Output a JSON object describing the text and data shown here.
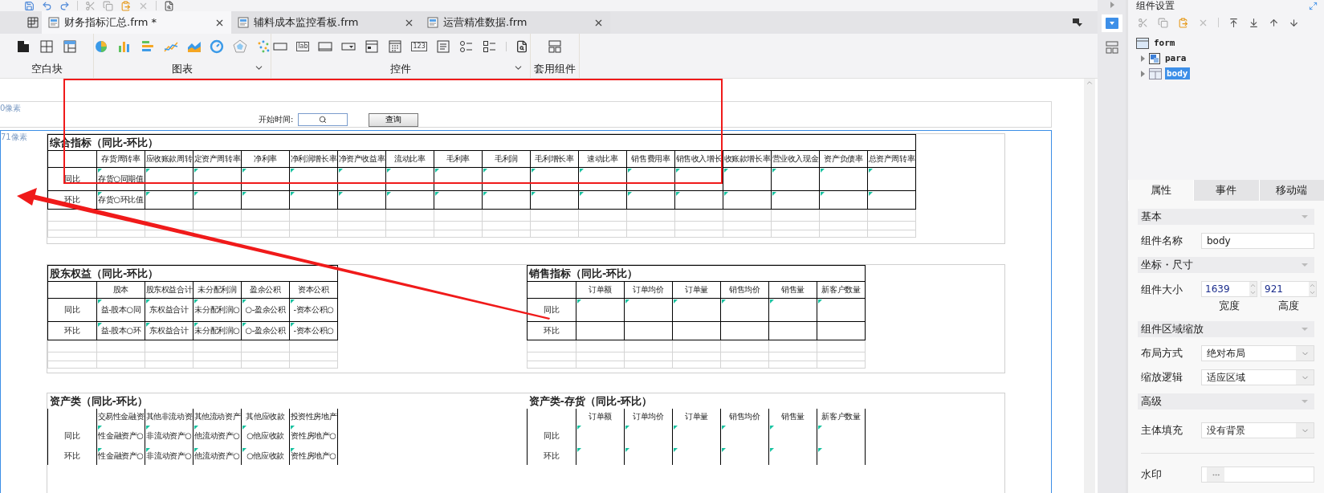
{
  "toolbar": {
    "tools": [
      {
        "kind": "save"
      },
      {
        "kind": "undo"
      },
      {
        "kind": "redo"
      },
      {
        "kind": "sep"
      },
      {
        "kind": "cut"
      },
      {
        "kind": "copy"
      },
      {
        "kind": "paste"
      },
      {
        "kind": "delete"
      },
      {
        "kind": "sep"
      },
      {
        "kind": "preview"
      }
    ]
  },
  "tabs": [
    {
      "label": "财务指标汇总.frm *",
      "selected": true
    },
    {
      "label": "辅料成本监控看板.frm",
      "selected": false
    },
    {
      "label": "运营精准数据.frm",
      "selected": false
    }
  ],
  "ribbon": {
    "groups": [
      {
        "label": "空白块",
        "menu": false,
        "tools": [
          {
            "kind": "block"
          },
          {
            "kind": "grid"
          },
          {
            "kind": "table"
          }
        ]
      },
      {
        "label": "图表",
        "menu": true,
        "tools": [
          {
            "kind": "pie"
          },
          {
            "kind": "bar"
          },
          {
            "kind": "hbar"
          },
          {
            "kind": "line"
          },
          {
            "kind": "area"
          },
          {
            "kind": "gauge"
          },
          {
            "kind": "radar"
          },
          {
            "kind": "scatter"
          }
        ]
      },
      {
        "label": "控件",
        "menu": true,
        "tools": [
          {
            "kind": "textbox"
          },
          {
            "kind": "glyph",
            "glyph": "lab"
          },
          {
            "kind": "textarea"
          },
          {
            "kind": "dropdown"
          },
          {
            "kind": "date"
          },
          {
            "kind": "calendar"
          },
          {
            "kind": "glyph",
            "glyph": "123"
          },
          {
            "kind": "list"
          },
          {
            "kind": "radio"
          },
          {
            "kind": "checkbox"
          },
          {
            "kind": "sep"
          },
          {
            "kind": "preview"
          }
        ]
      },
      {
        "label": "套用组件",
        "menu": false,
        "tools": [
          {
            "kind": "template"
          }
        ]
      }
    ]
  },
  "canvas": {
    "para": {
      "ruler": "0像素",
      "field_label": "开始时间:",
      "button": "查询"
    },
    "body": {
      "ruler": "71像素",
      "sections": [
        {
          "tables": [
            {
              "title": "综合指标（同比-环比）",
              "kind": "grid",
              "columns": [
                "存货周转率",
                "应收账款周转",
                "定资产周转率",
                "净利率",
                "净利润增长率",
                "净资产收益率",
                "流动比率",
                "毛利率",
                "毛利润",
                "毛利增长率",
                "速动比率",
                "销售费用率",
                "销售收入增长",
                "收账款增长率",
                "营业收入现金",
                "资产负债率",
                "总资产周转率"
              ],
              "rows": [
                {
                  "label": "同比",
                  "flagged": true,
                  "cells": [
                    "存货○同期值"
                  ]
                },
                {
                  "label": "环比",
                  "flagged": true,
                  "cells": [
                    "存货○环比值"
                  ]
                }
              ]
            }
          ]
        },
        {
          "tables": [
            {
              "title": "股东权益（同比-环比）",
              "kind": "grid",
              "columns": [
                "股本",
                "股东权益合计",
                "未分配利润",
                "盈余公积",
                "资本公积"
              ],
              "rows": [
                {
                  "label": "同比",
                  "flagged": true,
                  "cells": [
                    "益-股本○同",
                    "东权益合计",
                    "未分配利润○",
                    "○-盈余公积",
                    "-资本公积○"
                  ]
                },
                {
                  "label": "环比",
                  "flagged": true,
                  "cells": [
                    "益-股本○环",
                    "东权益合计",
                    "未分配利润○",
                    "○-盈余公积",
                    "-资本公积○"
                  ]
                }
              ]
            },
            {
              "title": "销售指标（同比-环比）",
              "kind": "grid",
              "columns": [
                "订单额",
                "订单均价",
                "订单量",
                "销售均价",
                "销售量",
                "新客户数量"
              ],
              "rows": [
                {
                  "label": "同比",
                  "flagged": true,
                  "cells": []
                },
                {
                  "label": "环比",
                  "flagged": false,
                  "cells": []
                }
              ]
            }
          ]
        },
        {
          "tables": [
            {
              "title": "资产类（同比-环比）",
              "kind": "ruled",
              "columns": [
                "交易性金融资",
                "其他非流动资",
                "其他流动资产",
                "其他应收款",
                "投资性房地产"
              ],
              "rows": [
                {
                  "label": "同比",
                  "flagged": true,
                  "cells": [
                    "性金融资产○",
                    "非流动资产○",
                    "他流动资产○",
                    "○他应收款",
                    "资性房地产○"
                  ]
                },
                {
                  "label": "环比",
                  "flagged": true,
                  "cells": [
                    "性金融资产○",
                    "非流动资产○",
                    "他流动资产○",
                    "○他应收款",
                    "资性房地产○"
                  ]
                }
              ]
            },
            {
              "title": "资产类-存货（同比-环比）",
              "kind": "ruled",
              "columns": [
                "订单额",
                "订单均价",
                "订单量",
                "销售均价",
                "销售量",
                "新客户数量"
              ],
              "rows": [
                {
                  "label": "同比",
                  "flagged": true,
                  "cells": []
                },
                {
                  "label": "环比",
                  "flagged": true,
                  "cells": []
                }
              ]
            }
          ]
        }
      ]
    }
  },
  "panel": {
    "title": "组件设置",
    "tools": [
      {
        "kind": "cut"
      },
      {
        "kind": "copy"
      },
      {
        "kind": "paste"
      },
      {
        "kind": "delete"
      },
      {
        "kind": "sep"
      },
      {
        "kind": "top"
      },
      {
        "kind": "bottom"
      },
      {
        "kind": "up"
      },
      {
        "kind": "down"
      }
    ],
    "tree": [
      {
        "label": "form",
        "kind": "form",
        "selected": false,
        "children": [
          {
            "label": "para",
            "kind": "para",
            "expanded": false,
            "selected": false
          },
          {
            "label": "body",
            "kind": "body",
            "expanded": false,
            "selected": true
          }
        ]
      }
    ],
    "tabs": [
      {
        "label": "属性",
        "selected": true
      },
      {
        "label": "事件",
        "selected": false
      },
      {
        "label": "移动端",
        "selected": false
      }
    ],
    "groups": [
      {
        "header": "基本",
        "rows": [
          {
            "kind": "text",
            "label": "组件名称",
            "value": "body"
          }
        ]
      },
      {
        "header": "坐标・尺寸",
        "rows": [
          {
            "kind": "size",
            "label": "组件大小",
            "fields": [
              {
                "value": "1639",
                "caption": "宽度"
              },
              {
                "value": "921",
                "caption": "高度"
              }
            ]
          }
        ]
      },
      {
        "header": "组件区域缩放",
        "rows": [
          {
            "kind": "select",
            "label": "布局方式",
            "value": "绝对布局"
          },
          {
            "kind": "select",
            "label": "缩放逻辑",
            "value": "适应区域"
          }
        ]
      },
      {
        "header": "高级",
        "rows": [
          {
            "kind": "select",
            "label": "主体填充",
            "value": "没有背景"
          },
          {
            "kind": "rule"
          },
          {
            "kind": "more",
            "label": "水印"
          }
        ]
      }
    ]
  }
}
